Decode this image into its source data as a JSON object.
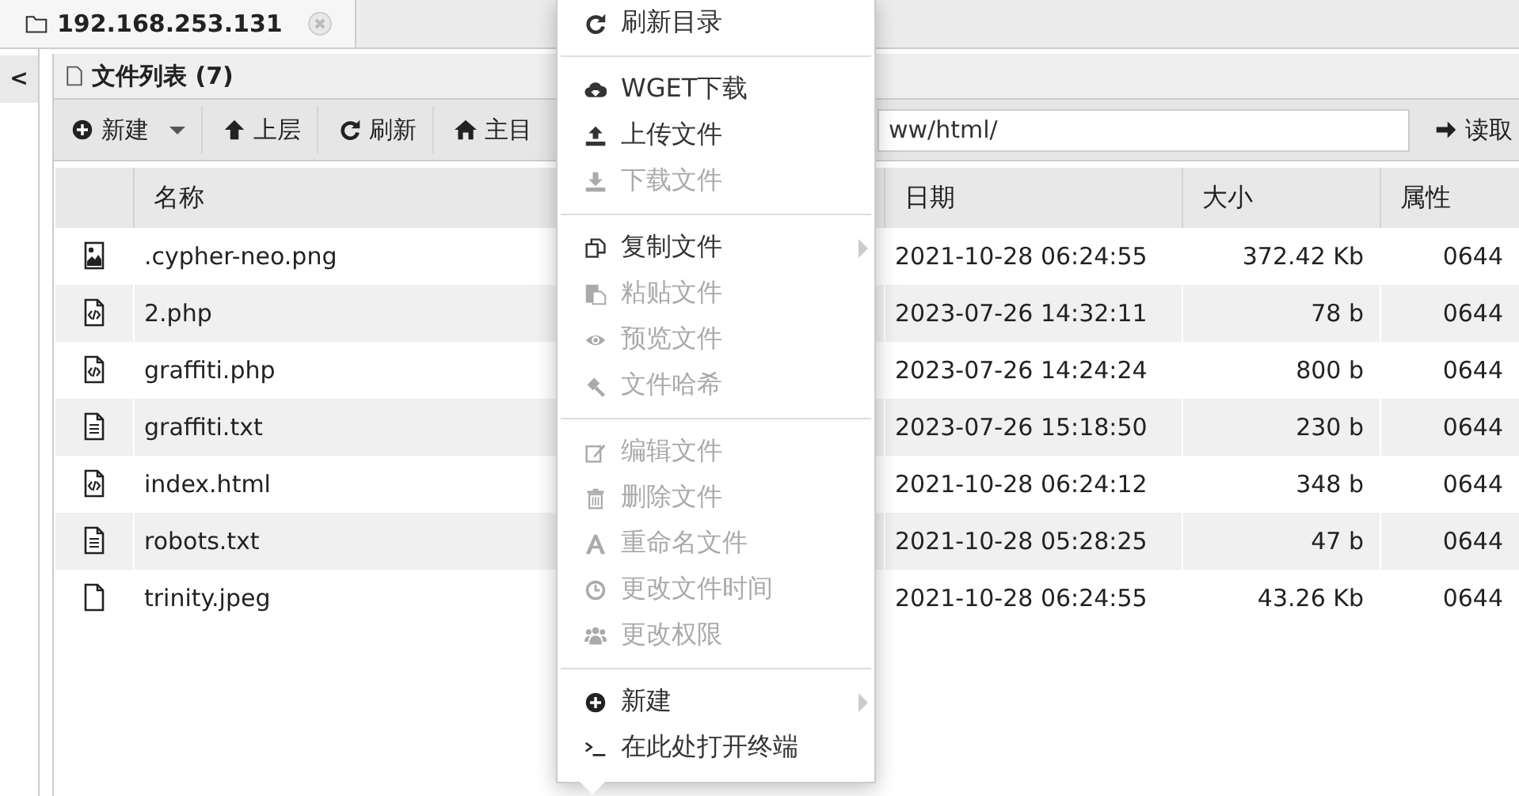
{
  "tab": {
    "title": "192.168.253.131",
    "selected": true
  },
  "sidebar": {
    "toggle": "<"
  },
  "panel": {
    "title": "文件列表 (7)"
  },
  "toolbar": {
    "buttons": [
      {
        "label": "新建",
        "dropdown": true
      },
      {
        "label": "上层",
        "dropdown": false
      },
      {
        "label": "刷新",
        "dropdown": false
      },
      {
        "label": "主目",
        "dropdown": false
      }
    ],
    "path_field": {
      "value": "ww/html/"
    },
    "load_button": {
      "label": "读取"
    }
  },
  "table": {
    "columns": [
      "名称",
      "日期",
      "大小",
      "属性"
    ],
    "rows": [
      {
        "name": ".cypher-neo.png",
        "date": "2021-10-28 06:24:55",
        "size": "372.42 Kb",
        "attributes": "0644"
      },
      {
        "name": "2.php",
        "date": "2023-07-26 14:32:11",
        "size": "78 b",
        "attributes": "0644"
      },
      {
        "name": "graffiti.php",
        "date": "2023-07-26 14:24:24",
        "size": "800 b",
        "attributes": "0644"
      },
      {
        "name": "graffiti.txt",
        "date": "2023-07-26 15:18:50",
        "size": "230 b",
        "attributes": "0644"
      },
      {
        "name": "index.html",
        "date": "2021-10-28 06:24:12",
        "size": "348 b",
        "attributes": "0644"
      },
      {
        "name": "robots.txt",
        "date": "2021-10-28 05:28:25",
        "size": "47 b",
        "attributes": "0644"
      },
      {
        "name": "trinity.jpeg",
        "date": "2021-10-28 06:24:55",
        "size": "43.26 Kb",
        "attributes": "0644"
      }
    ]
  },
  "context_menu": {
    "groups": [
      [
        {
          "label": "刷新目录",
          "disabled": false,
          "submenu": false
        }
      ],
      [
        {
          "label": "WGET下载",
          "disabled": false,
          "submenu": false
        },
        {
          "label": "上传文件",
          "disabled": false,
          "submenu": false
        },
        {
          "label": "下载文件",
          "disabled": true,
          "submenu": false
        }
      ],
      [
        {
          "label": "复制文件",
          "disabled": false,
          "submenu": true
        },
        {
          "label": "粘贴文件",
          "disabled": true,
          "submenu": false
        },
        {
          "label": "预览文件",
          "disabled": true,
          "submenu": false
        },
        {
          "label": "文件哈希",
          "disabled": true,
          "submenu": false
        }
      ],
      [
        {
          "label": "编辑文件",
          "disabled": true,
          "submenu": false
        },
        {
          "label": "删除文件",
          "disabled": true,
          "submenu": false
        },
        {
          "label": "重命名文件",
          "disabled": true,
          "submenu": false
        },
        {
          "label": "更改文件时间",
          "disabled": true,
          "submenu": false
        },
        {
          "label": "更改权限",
          "disabled": true,
          "submenu": false
        }
      ],
      [
        {
          "label": "新建",
          "disabled": false,
          "submenu": true
        },
        {
          "label": "在此处打开终端",
          "disabled": false,
          "submenu": false
        }
      ]
    ]
  }
}
